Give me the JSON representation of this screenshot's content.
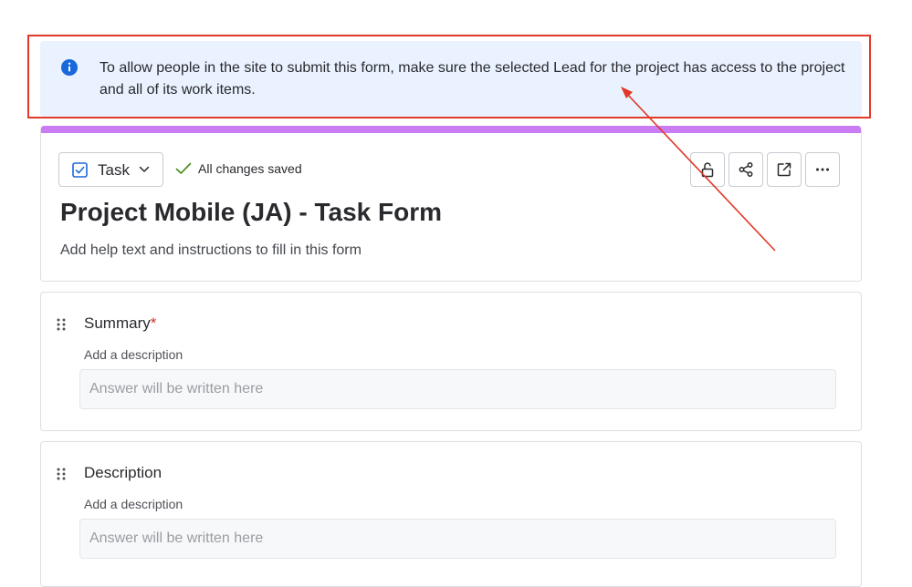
{
  "banner": {
    "text": "To allow people in the site to submit this form, make sure the selected Lead for the project has access to the project and all of its work items.",
    "icon": "info-icon",
    "bg_color": "#e9f2fe",
    "icon_color": "#1868db"
  },
  "annotation": {
    "color": "#e2382a"
  },
  "header": {
    "accent_color": "#c97cf4",
    "type_label": "Task",
    "saved_text": "All changes saved",
    "title": "Project Mobile (JA) - Task Form",
    "help_text": "Add help text and instructions to fill in this form",
    "actions": [
      "unlock-icon",
      "share-icon",
      "open-external-icon",
      "more-icon"
    ]
  },
  "fields": [
    {
      "label": "Summary",
      "required_mark": "*",
      "description": "Add a description",
      "placeholder": "Answer will be written here"
    },
    {
      "label": "Description",
      "description": "Add a description",
      "placeholder": "Answer will be written here"
    }
  ]
}
